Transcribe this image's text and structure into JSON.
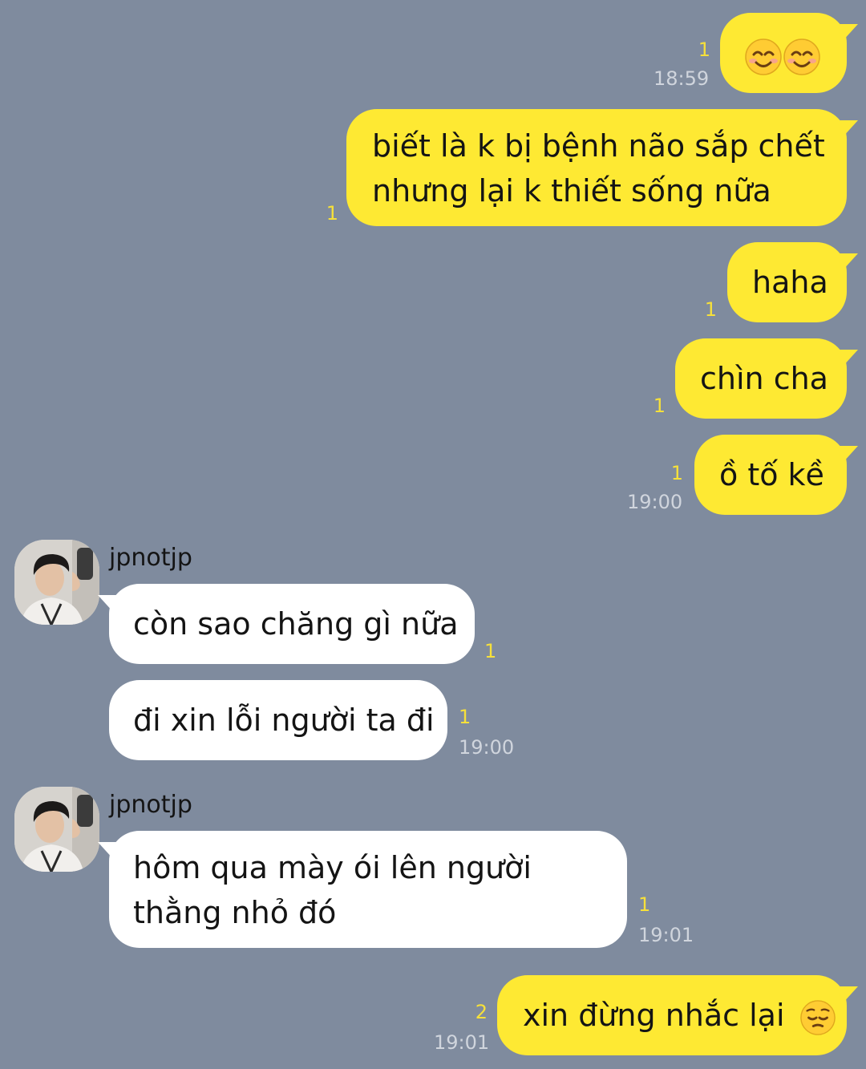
{
  "contact": {
    "name": "jpnotjp"
  },
  "messages": [
    {
      "from": "me",
      "text": "",
      "emoji": [
        "smiling-face-icon",
        "smiling-face-icon"
      ],
      "unread": "1",
      "time": "18:59"
    },
    {
      "from": "me",
      "lines": [
        "biết là k bị bệnh não sắp chết",
        "nhưng lại k thiết sống nữa"
      ],
      "unread": "1"
    },
    {
      "from": "me",
      "text": "haha",
      "unread": "1"
    },
    {
      "from": "me",
      "text": "chìn cha",
      "unread": "1"
    },
    {
      "from": "me",
      "text": "ồ tố kề",
      "unread": "1",
      "time": "19:00"
    },
    {
      "from": "them",
      "sender": "jpnotjp",
      "text": "còn sao chăng gì nữa",
      "unread": "1"
    },
    {
      "from": "them",
      "text": "đi xin lỗi người ta đi",
      "unread": "1",
      "time": "19:00"
    },
    {
      "from": "them",
      "sender": "jpnotjp",
      "lines": [
        "hôm qua mày ói lên người",
        "thằng nhỏ đó"
      ],
      "unread": "1",
      "time": "19:01"
    },
    {
      "from": "me",
      "text": "xin đừng nhắc lại",
      "emoji": [
        "pensive-face-icon"
      ],
      "unread": "2",
      "time": "19:01"
    }
  ],
  "colors": {
    "background": "#7f8b9e",
    "my_bubble": "#fee933",
    "their_bubble": "#ffffff",
    "unread_count": "#f6e03a",
    "timestamp": "#d0d5dd"
  }
}
